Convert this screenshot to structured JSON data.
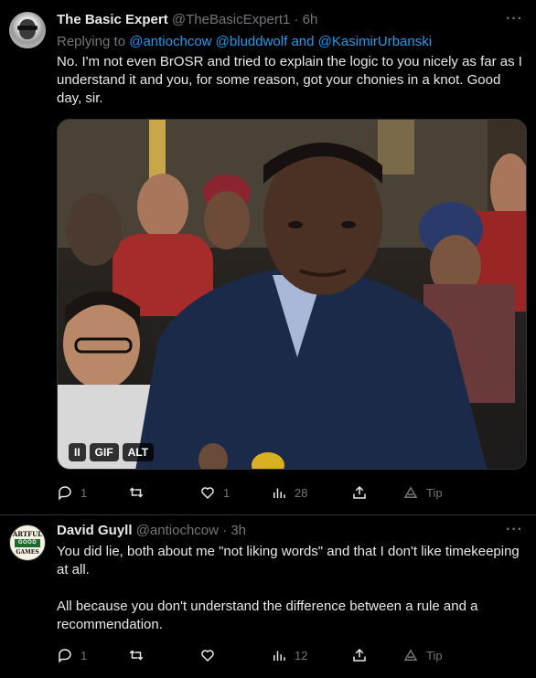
{
  "tweets": [
    {
      "name": "The Basic Expert",
      "handle": "@TheBasicExpert1",
      "time": "· 6h",
      "more": "···",
      "replying_prefix": "Replying to",
      "mentions": [
        "@antiochcow",
        "@bluddwolf",
        "and",
        "@KasimirUrbanski"
      ],
      "text": "No. I'm not even BrOSR and tried to explain the logic to you nicely as far as I understand it and you, for some reason, got your chonies in a knot. Good day, sir.",
      "media_badges": [
        "II",
        "GIF",
        "ALT"
      ],
      "replies": "1",
      "retweets": "",
      "likes": "1",
      "views": "28",
      "tip": "Tip"
    },
    {
      "name": "David Guyll",
      "handle": "@antiochcow",
      "time": "· 3h",
      "more": "···",
      "avatar_text": [
        "ARTFUL",
        "GOOD",
        "GAMES"
      ],
      "text": "You did lie, both about me \"not liking words\" and that I don't like timekeeping at all.\n\nAll because you don't understand the difference between a rule and a recommendation.",
      "replies": "1",
      "retweets": "",
      "likes": "",
      "views": "12",
      "tip": "Tip"
    }
  ],
  "colors": {
    "background": "#000000",
    "text": "#e7e9ea",
    "muted": "#71767b",
    "link": "#1d9bf0",
    "border": "#2f3336"
  }
}
